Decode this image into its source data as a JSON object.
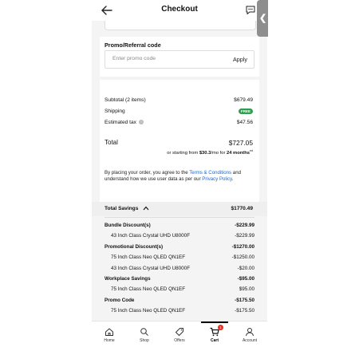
{
  "header": {
    "title": "Checkout"
  },
  "promo": {
    "title": "Promo/Referral code",
    "placeholder": "Enter promo code",
    "apply": "Apply"
  },
  "summary": {
    "subtotal_label": "Subtotal (2 items)",
    "subtotal_value": "$679.49",
    "shipping_label": "Shipping",
    "shipping_value": "FREE",
    "tax_label": "Estimated tax",
    "tax_value": "$47.56",
    "total_label": "Total",
    "total_value": "$727.05",
    "starting_prefix": "or starting from ",
    "starting_amount": "$30.3",
    "starting_mid": "/mo for ",
    "starting_months": "24 months",
    "starting_mark": "ed"
  },
  "legal": {
    "text1": "By placing your order, you agree to the ",
    "terms_link": "Terms & Conditions",
    "text2": " and understand how we use user data as per our ",
    "privacy_link": "Privacy Policy",
    "text3": "."
  },
  "savings": {
    "label": "Total Savings",
    "value": "$1770.49",
    "rows": [
      {
        "label": "Bundle Discount(s)",
        "value": "-$229.99",
        "bold": true
      },
      {
        "label": "43 Inch Class Crystal UHD U8000F",
        "value": "-$229.99",
        "bold": false
      },
      {
        "label": "Promotional Discount(s)",
        "value": "-$1270.00",
        "bold": true
      },
      {
        "label": "75 Inch Class Neo QLED QN1EF",
        "value": "-$1250.00",
        "bold": false
      },
      {
        "label": "43 Inch Class Crystal UHD U8000F",
        "value": "-$20.00",
        "bold": false
      },
      {
        "label": "Workplace Savings",
        "value": "-$95.00",
        "bold": true
      },
      {
        "label": "75 Inch Class Neo QLED QN1EF",
        "value": "$95.00",
        "bold": false
      },
      {
        "label": "Promo Code",
        "value": "-$175.50",
        "bold": true
      },
      {
        "label": "75 Inch Class Neo QLED QN1EF",
        "value": "-$175.50",
        "bold": false
      }
    ]
  },
  "tabs": [
    {
      "label": "Home",
      "icon": "home-icon"
    },
    {
      "label": "Shop",
      "icon": "search-icon"
    },
    {
      "label": "Offers",
      "icon": "tag-icon"
    },
    {
      "label": "Cart",
      "icon": "cart-icon",
      "active": true,
      "badge": "1"
    },
    {
      "label": "Account",
      "icon": "person-icon"
    }
  ],
  "colors": {
    "link": "#1769d8",
    "free_badge": "#2e9e4f",
    "cart_badge": "#e0341e"
  }
}
